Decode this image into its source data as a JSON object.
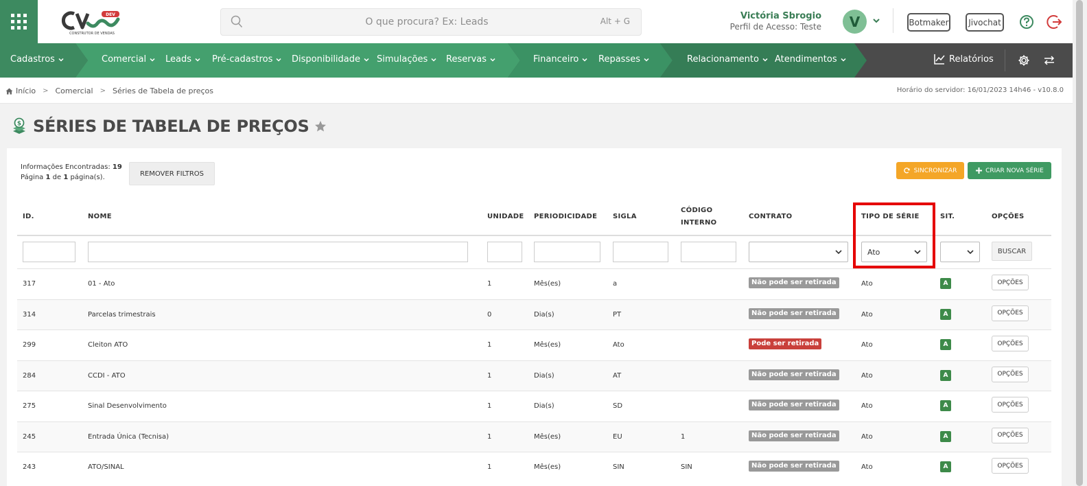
{
  "header": {
    "logo_badge": "DEV",
    "logo_subtitle": "CONSTRUTOR DE VENDAS",
    "search_placeholder": "O que procura? Ex: Leads",
    "search_shortcut": "Alt + G",
    "user_name": "Victória Sbrogio",
    "user_profile": "Perfil de Acesso: Teste",
    "avatar_initial": "V",
    "botmaker_label": "Botmaker",
    "jivochat_label": "Jivochat"
  },
  "nav": {
    "items": [
      {
        "label": "Cadastros"
      },
      {
        "label": "Comercial"
      },
      {
        "label": "Leads"
      },
      {
        "label": "Pré-cadastros"
      },
      {
        "label": "Disponibilidade"
      },
      {
        "label": "Simulações"
      },
      {
        "label": "Reservas"
      },
      {
        "label": "Financeiro"
      },
      {
        "label": "Repasses"
      },
      {
        "label": "Relacionamento"
      },
      {
        "label": "Atendimentos"
      }
    ],
    "reports_label": "Relatórios",
    "colors": {
      "green_1": "#3d8a60",
      "green_2": "#43996a",
      "green_3": "#3a8d60",
      "green_4": "#347a55",
      "dark": "#4b4b4b"
    }
  },
  "breadcrumb": {
    "home": "Início",
    "level1": "Comercial",
    "level2": "Séries de Tabela de preços",
    "server_time": "Horário do servidor: 16/01/2023 14h46 - v10.8.0"
  },
  "page": {
    "title": "SÉRIES DE TABELA DE PREÇOS"
  },
  "toolbar": {
    "info_prefix": "Informações Encontradas:",
    "info_count": "19",
    "page_word": "Página",
    "page_current": "1",
    "page_of": "de",
    "page_total": "1",
    "page_suffix": "página(s).",
    "remove_filters": "REMOVER FILTROS",
    "sync": "SINCRONIZAR",
    "create": "CRIAR NOVA SÉRIE"
  },
  "table": {
    "headers": {
      "id": "ID.",
      "nome": "NOME",
      "unidade": "UNIDADE",
      "periodicidade": "PERIODICIDADE",
      "sigla": "SIGLA",
      "codigo_1": "CÓDIGO",
      "codigo_2": "INTERNO",
      "contrato": "CONTRATO",
      "tipo": "TIPO DE SÉRIE",
      "sit": "SIT.",
      "opcoes": "OPÇÕES"
    },
    "filters": {
      "tipo_selected": "Ato",
      "buscar": "BUSCAR"
    },
    "options_label": "OPÇÕES",
    "rows": [
      {
        "id": "317",
        "nome": "01 - Ato",
        "unidade": "1",
        "periodicidade": "Mês(es)",
        "sigla": "a",
        "codigo": "",
        "contrato": "Não pode ser retirada",
        "contrato_type": "grey",
        "tipo": "Ato",
        "sit": "A"
      },
      {
        "id": "314",
        "nome": "Parcelas trimestrais",
        "unidade": "0",
        "periodicidade": "Dia(s)",
        "sigla": "PT",
        "codigo": "",
        "contrato": "Não pode ser retirada",
        "contrato_type": "grey",
        "tipo": "Ato",
        "sit": "A"
      },
      {
        "id": "299",
        "nome": "Cleiton ATO",
        "unidade": "1",
        "periodicidade": "Mês(es)",
        "sigla": "Ato",
        "codigo": "",
        "contrato": "Pode ser retirada",
        "contrato_type": "red",
        "tipo": "Ato",
        "sit": "A"
      },
      {
        "id": "284",
        "nome": "CCDI - ATO",
        "unidade": "1",
        "periodicidade": "Dia(s)",
        "sigla": "AT",
        "codigo": "",
        "contrato": "Não pode ser retirada",
        "contrato_type": "grey",
        "tipo": "Ato",
        "sit": "A"
      },
      {
        "id": "275",
        "nome": "Sinal Desenvolvimento",
        "unidade": "1",
        "periodicidade": "Dia(s)",
        "sigla": "SD",
        "codigo": "",
        "contrato": "Não pode ser retirada",
        "contrato_type": "grey",
        "tipo": "Ato",
        "sit": "A"
      },
      {
        "id": "245",
        "nome": "Entrada Única (Tecnisa)",
        "unidade": "1",
        "periodicidade": "Mês(es)",
        "sigla": "EU",
        "codigo": "1",
        "contrato": "Não pode ser retirada",
        "contrato_type": "grey",
        "tipo": "Ato",
        "sit": "A"
      },
      {
        "id": "243",
        "nome": "ATO/SINAL",
        "unidade": "1",
        "periodicidade": "Mês(es)",
        "sigla": "SIN",
        "codigo": "SIN",
        "contrato": "Não pode ser retirada",
        "contrato_type": "grey",
        "tipo": "Ato",
        "sit": "A"
      }
    ]
  }
}
